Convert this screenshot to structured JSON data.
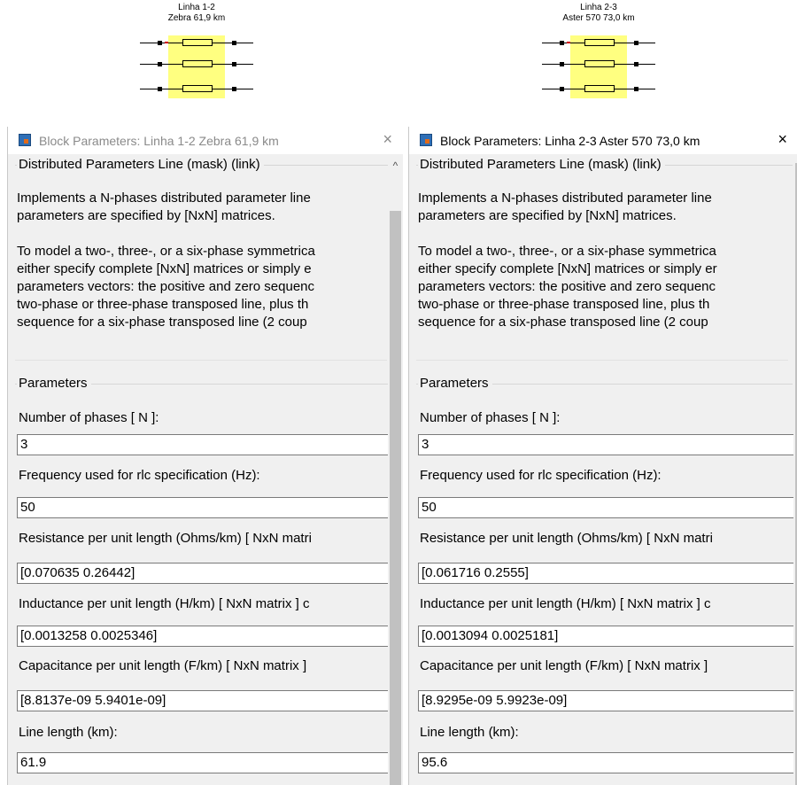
{
  "blocks": [
    {
      "name": "Linha 1-2",
      "spec": "Zebra 61,9 km"
    },
    {
      "name": "Linha 2-3",
      "spec": "Aster 570  73,0 km"
    }
  ],
  "dialogs": [
    {
      "title": "Block Parameters: Linha 1-2 Zebra 61,9 km",
      "close": "×",
      "section_title": "Distributed Parameters Line (mask) (link)",
      "description": [
        "Implements a N-phases distributed parameter line",
        "parameters are specified by [NxN] matrices.",
        "",
        "To model a two-, three-, or a six-phase symmetrica",
        "either specify complete [NxN] matrices or simply e",
        "parameters vectors: the  positive and zero sequenc",
        "two-phase or  three-phase transposed  line, plus th",
        "sequence for a  six-phase transposed  line  (2 coup"
      ],
      "params_title": "Parameters",
      "fields": [
        {
          "label": "Number of phases [ N ]:",
          "value": "3"
        },
        {
          "label": "Frequency used for rlc specification (Hz):",
          "value": "50"
        },
        {
          "label": "Resistance per unit length (Ohms/km) [ NxN matri",
          "value": "[0.070635 0.26442]"
        },
        {
          "label": "Inductance per unit length (H/km) [ NxN matrix ] c",
          "value": "[0.0013258 0.0025346]"
        },
        {
          "label": "Capacitance per unit length (F/km) [ NxN matrix ]",
          "value": "[8.8137e-09 5.9401e-09]"
        },
        {
          "label": "Line length (km):",
          "value": "61.9"
        }
      ]
    },
    {
      "title": "Block Parameters: Linha 2-3 Aster 570  73,0 km",
      "close": "×",
      "section_title": "Distributed Parameters Line (mask) (link)",
      "description": [
        "Implements a N-phases distributed parameter line",
        "parameters are specified by [NxN] matrices.",
        "",
        "To model a two-, three-, or a six-phase symmetrica",
        "either specify complete [NxN] matrices or simply er",
        "parameters vectors: the  positive and zero sequenc",
        "two-phase or  three-phase transposed  line, plus th",
        "sequence for a  six-phase transposed  line  (2 coup"
      ],
      "params_title": "Parameters",
      "fields": [
        {
          "label": "Number of phases [ N ]:",
          "value": "3"
        },
        {
          "label": "Frequency used for rlc specification (Hz):",
          "value": "50"
        },
        {
          "label": "Resistance per unit length (Ohms/km) [ NxN matri",
          "value": "[0.061716 0.2555]"
        },
        {
          "label": "Inductance per unit length (H/km) [ NxN matrix ] c",
          "value": "[0.0013094 0.0025181]"
        },
        {
          "label": "Capacitance per unit length (F/km) [ NxN matrix ]",
          "value": "[8.9295e-09 5.9923e-09]"
        },
        {
          "label": "Line length (km):",
          "value": "95.6"
        }
      ]
    }
  ],
  "icons": {
    "dialog_app": "simulink-block-icon",
    "close": "close-icon",
    "scroll_up": "scroll-up-arrow-icon"
  },
  "colors": {
    "block_fill": "#ffff80",
    "dialog_bg": "#f0f0f0",
    "titlebar_bg": "#ffffff",
    "scroll_thumb": "#c1c1c1"
  }
}
